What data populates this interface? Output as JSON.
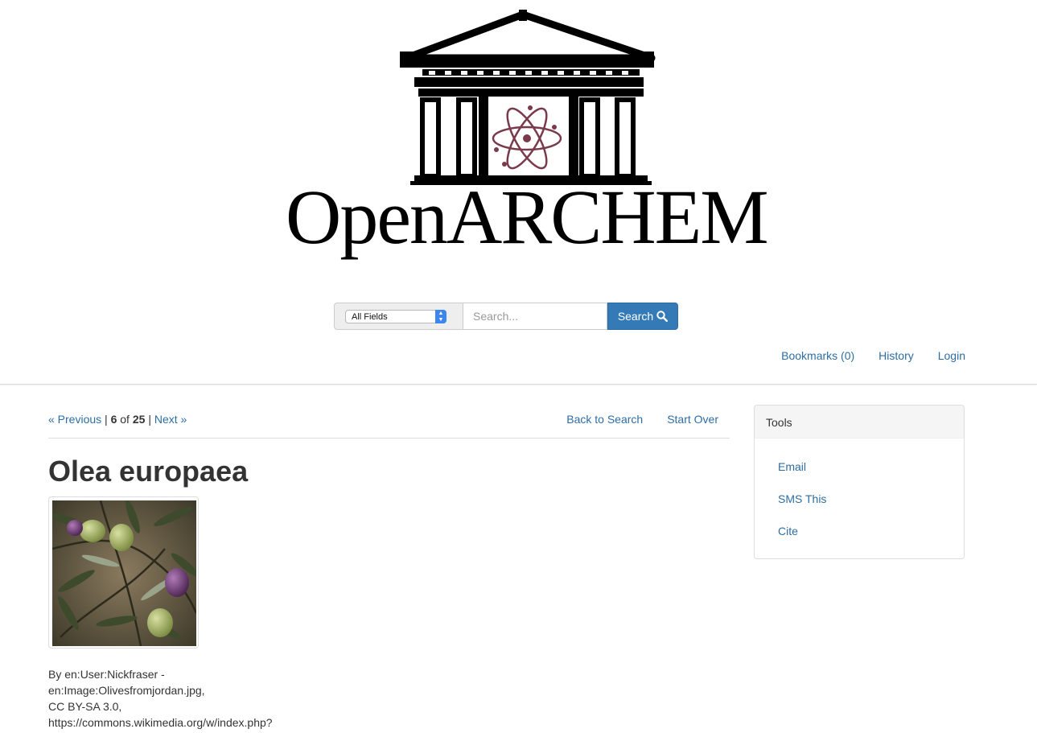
{
  "header": {
    "logo_text": "OpenARCHEM",
    "logo_colors": {
      "ink": "#000000",
      "atom": "#7a3a4c"
    },
    "search": {
      "field_selected": "All Fields",
      "placeholder": "Search...",
      "button_label": "Search"
    },
    "user_nav": [
      {
        "label": "Bookmarks (0)"
      },
      {
        "label": "History"
      },
      {
        "label": "Login"
      }
    ]
  },
  "search_context": {
    "previous_label": "« Previous",
    "separator": "|",
    "current": "6",
    "of_label": "of",
    "total": "25",
    "next_label": "Next »",
    "back_to_search": "Back to Search",
    "start_over": "Start Over"
  },
  "document": {
    "title": "Olea europaea",
    "attribution_lines": [
      "By en:User:Nickfraser -",
      "en:Image:Olivesfromjordan.jpg,",
      "CC BY-SA 3.0,",
      "https://commons.wikimedia.org/w/index.php?"
    ]
  },
  "sidebar": {
    "heading": "Tools",
    "items": [
      {
        "label": "Email"
      },
      {
        "label": "SMS This"
      },
      {
        "label": "Cite"
      }
    ]
  },
  "colors": {
    "link": "#2e6da4",
    "primary_button": "#337ab7",
    "text": "#333333",
    "panel_heading": "#f5f5f5"
  }
}
